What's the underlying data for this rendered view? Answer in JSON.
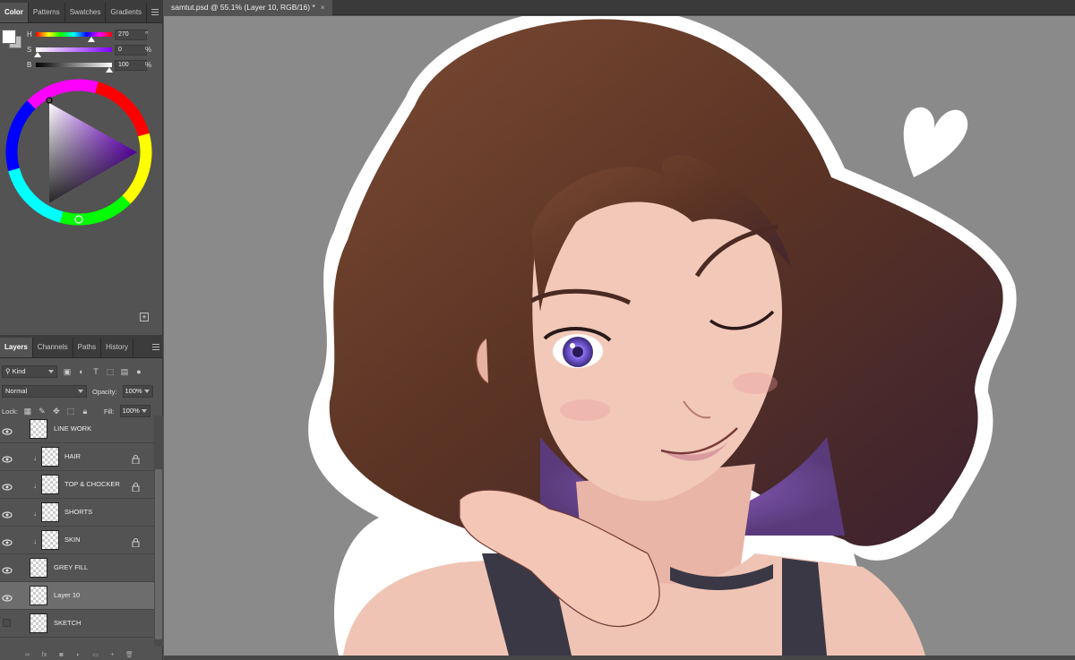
{
  "color_panel": {
    "tabs": [
      "Color",
      "Patterns",
      "Swatches",
      "Gradients"
    ],
    "h": {
      "label": "H",
      "value": "270",
      "unit": "°"
    },
    "s": {
      "label": "S",
      "value": "0",
      "unit": "%"
    },
    "b": {
      "label": "B",
      "value": "100",
      "unit": "%"
    }
  },
  "layers_panel": {
    "tabs": [
      "Layers",
      "Channels",
      "Paths",
      "History"
    ],
    "kind_filter": "Kind",
    "blend_mode": "Normal",
    "opacity_label": "Opacity:",
    "opacity_value": "100%",
    "lock_label": "Lock:",
    "fill_label": "Fill:",
    "fill_value": "100%",
    "layers": [
      {
        "name": "LINE WORK",
        "visible": true,
        "clipped": false,
        "locked": false,
        "selected": false
      },
      {
        "name": "HAIR",
        "visible": true,
        "clipped": true,
        "locked": true,
        "selected": false
      },
      {
        "name": "TOP & CHOCKER",
        "visible": true,
        "clipped": true,
        "locked": true,
        "selected": false
      },
      {
        "name": "SHORTS",
        "visible": true,
        "clipped": true,
        "locked": false,
        "selected": false
      },
      {
        "name": "SKIN",
        "visible": true,
        "clipped": true,
        "locked": true,
        "selected": false
      },
      {
        "name": "GREY FILL",
        "visible": true,
        "clipped": false,
        "locked": false,
        "selected": false
      },
      {
        "name": "Layer 10",
        "visible": true,
        "clipped": false,
        "locked": false,
        "selected": true
      },
      {
        "name": "SKETCH",
        "visible": false,
        "clipped": false,
        "locked": false,
        "selected": false
      }
    ]
  },
  "document": {
    "tab_title": "samtut.psd @ 55.1% (Layer 10, RGB/16) *",
    "close_glyph": "×"
  },
  "colors": {
    "canvas_bg": "#8a8a8a",
    "hair": "#5a3324",
    "skin": "#f0c4b4",
    "iris": "#7b5fe0"
  }
}
